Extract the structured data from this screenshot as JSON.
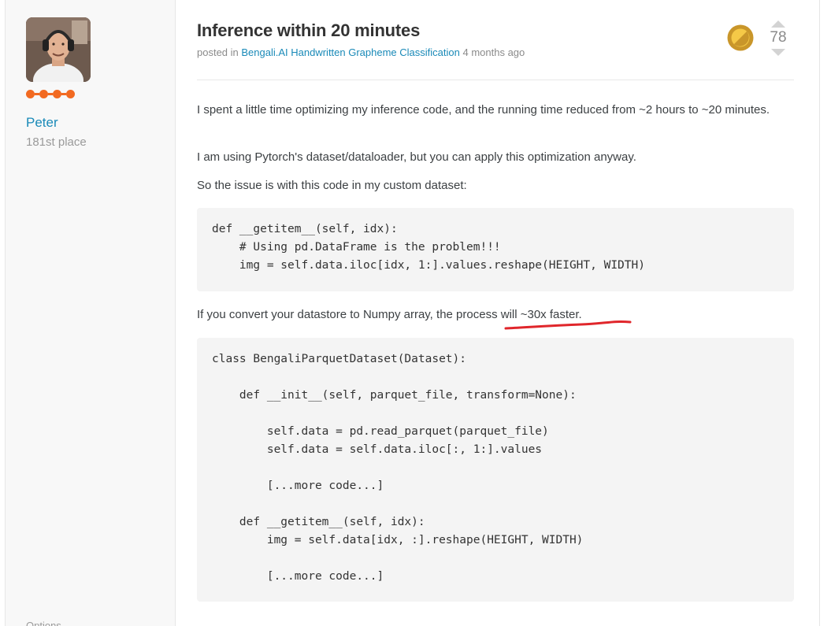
{
  "author": {
    "name": "Peter",
    "rank": "181st place",
    "footer_label": "Options"
  },
  "post": {
    "title": "Inference within 20 minutes",
    "meta_prefix": "posted in",
    "competition": "Bengali.AI Handwritten Grapheme Classification",
    "time": "4 months ago",
    "votes": "78"
  },
  "body": {
    "p1": "I spent a little time optimizing my inference code, and the running time reduced from ~2 hours to ~20 minutes.",
    "p2": "I am using Pytorch's dataset/dataloader, but you can apply this optimization anyway.",
    "p3": "So the issue is with this code in my custom dataset:",
    "code1": "def __getitem__(self, idx):\n    # Using pd.DataFrame is the problem!!!\n    img = self.data.iloc[idx, 1:].values.reshape(HEIGHT, WIDTH)",
    "p4": "If you convert your datastore to Numpy array, the process will ~30x faster.",
    "code2": "class BengaliParquetDataset(Dataset):\n\n    def __init__(self, parquet_file, transform=None):\n\n        self.data = pd.read_parquet(parquet_file)\n        self.data = self.data.iloc[:, 1:].values\n\n        [...more code...]\n\n    def __getitem__(self, idx):\n        img = self.data[idx, :].reshape(HEIGHT, WIDTH)\n\n        [...more code...]"
  },
  "colors": {
    "link": "#1a8ab8",
    "tier": "#f26a21",
    "medal": "#c9962a",
    "annotation": "#e0262b"
  },
  "icons": {
    "medal": "gold-medal-icon",
    "upvote": "triangle-up-icon",
    "downvote": "triangle-down-icon"
  }
}
